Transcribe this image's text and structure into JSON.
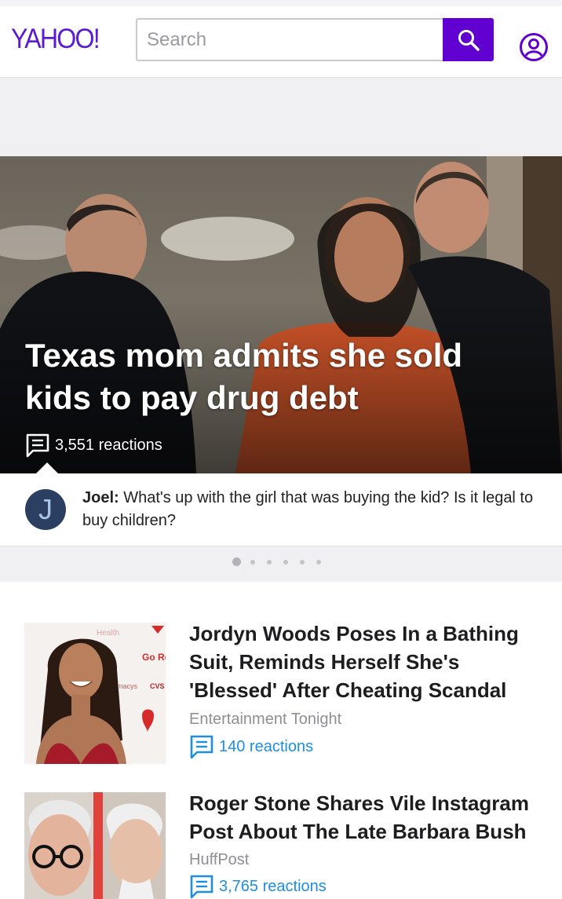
{
  "header": {
    "logo": "YAHOO!",
    "search_placeholder": "Search",
    "search_button_icon": "search-icon",
    "profile_icon": "user-circle-icon",
    "brand_color": "#6001d2"
  },
  "hero": {
    "title": "Texas mom admits she sold kids to pay drug debt",
    "reactions": "3,551 reactions",
    "reactions_icon": "comment-icon"
  },
  "top_comment": {
    "avatar_initial": "J",
    "author": "Joel:",
    "text": "What's up with the girl that was buying the kid? Is it legal to buy children?"
  },
  "carousel": {
    "dot_count": 6,
    "active_index": 0
  },
  "stories": [
    {
      "title": "Jordyn Woods Poses In a Bathing Suit, Reminds Herself She's 'Blessed' After Cheating Scandal",
      "source": "Entertainment Tonight",
      "reactions": "140 reactions",
      "thumb_sign": {
        "health": "Health",
        "go_red": "Go Red",
        "macys": "macys",
        "cvs": "CVS"
      }
    },
    {
      "title": "Roger Stone Shares Vile Instagram Post About The Late Barbara Bush",
      "source": "HuffPost",
      "reactions": "3,765 reactions"
    }
  ],
  "colors": {
    "link_blue": "#1d8fe0",
    "separator_gray": "#f0f0f3"
  }
}
